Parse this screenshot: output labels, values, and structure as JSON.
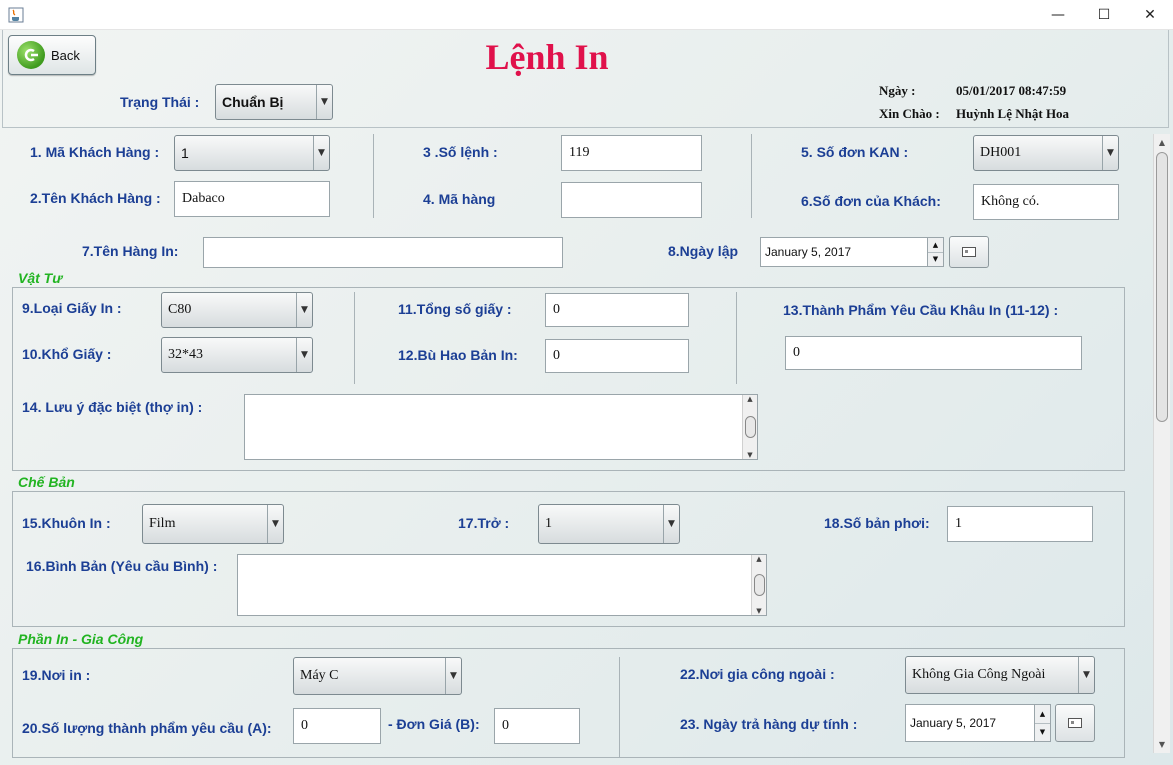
{
  "window": {
    "minimize": "—",
    "maximize": "☐",
    "close": "✕"
  },
  "header": {
    "back_label": "Back",
    "title": "Lệnh In",
    "status_label": "Trạng Thái :",
    "status_value": "Chuẩn Bị",
    "date_label": "Ngày :",
    "date_value": "05/01/2017 08:47:59",
    "greeting_label": "Xin Chào :",
    "greeting_value": "Huỳnh Lệ Nhật Hoa"
  },
  "order": {
    "ma_khach_hang_label": "1. Mã Khách Hàng :",
    "ma_khach_hang_value": "1",
    "ten_khach_hang_label": "2.Tên Khách Hàng :",
    "ten_khach_hang_value": "Dabaco",
    "so_lenh_label": "3 .Số lệnh :",
    "so_lenh_value": "119",
    "ma_hang_label": "4. Mã hàng",
    "ma_hang_value": "",
    "so_don_kan_label": "5. Số đơn KAN :",
    "so_don_kan_value": "DH001",
    "so_don_khach_label": "6.Số đơn của Khách:",
    "so_don_khach_value": "Không có.",
    "ten_hang_in_label": "7.Tên Hàng In:",
    "ten_hang_in_value": "",
    "ngay_lap_label": "8.Ngày lập",
    "ngay_lap_value": "January 5, 2017"
  },
  "vat_tu": {
    "title": "Vật Tư",
    "loai_giay_label": "9.Loại Giấy In :",
    "loai_giay_value": "C80",
    "kho_giay_label": "10.Khổ Giấy :",
    "kho_giay_value": "32*43",
    "tong_so_giay_label": "11.Tổng số giấy :",
    "tong_so_giay_value": "0",
    "bu_hao_label": "12.Bù Hao Bản In:",
    "bu_hao_value": "0",
    "thanh_pham_label": "13.Thành Phẩm Yêu Cầu Khâu In (11-12)  :",
    "thanh_pham_value": "0",
    "luu_y_label": "14. Lưu ý đặc biệt (thợ in)  :"
  },
  "che_ban": {
    "title": "Chế Bản",
    "khuon_in_label": "15.Khuôn In :",
    "khuon_in_value": "Film",
    "binh_ban_label": "16.Bình Bản (Yêu cầu Bình) :",
    "tro_label": "17.Trở :",
    "tro_value": "1",
    "so_ban_phoi_label": "18.Số bản phơi:",
    "so_ban_phoi_value": "1"
  },
  "phan_in": {
    "title": "Phần In - Gia Công",
    "noi_in_label": "19.Nơi in :",
    "noi_in_value": "Máy C",
    "so_luong_label": "20.Số lượng thành phẩm yêu cầu (A):",
    "so_luong_value": "0",
    "don_gia_label": "- Đơn Giá (B):",
    "don_gia_value": "0",
    "noi_gia_cong_label": "22.Nơi gia công ngoài :",
    "noi_gia_cong_value": "Không Gia Công Ngoài",
    "ngay_tra_label": "23. Ngày trả hàng dự tính :",
    "ngay_tra_value": "January 5, 2017"
  },
  "colors": {
    "label_blue": "#1c3f95",
    "title_red": "#e0114b",
    "section_green": "#22b422"
  }
}
